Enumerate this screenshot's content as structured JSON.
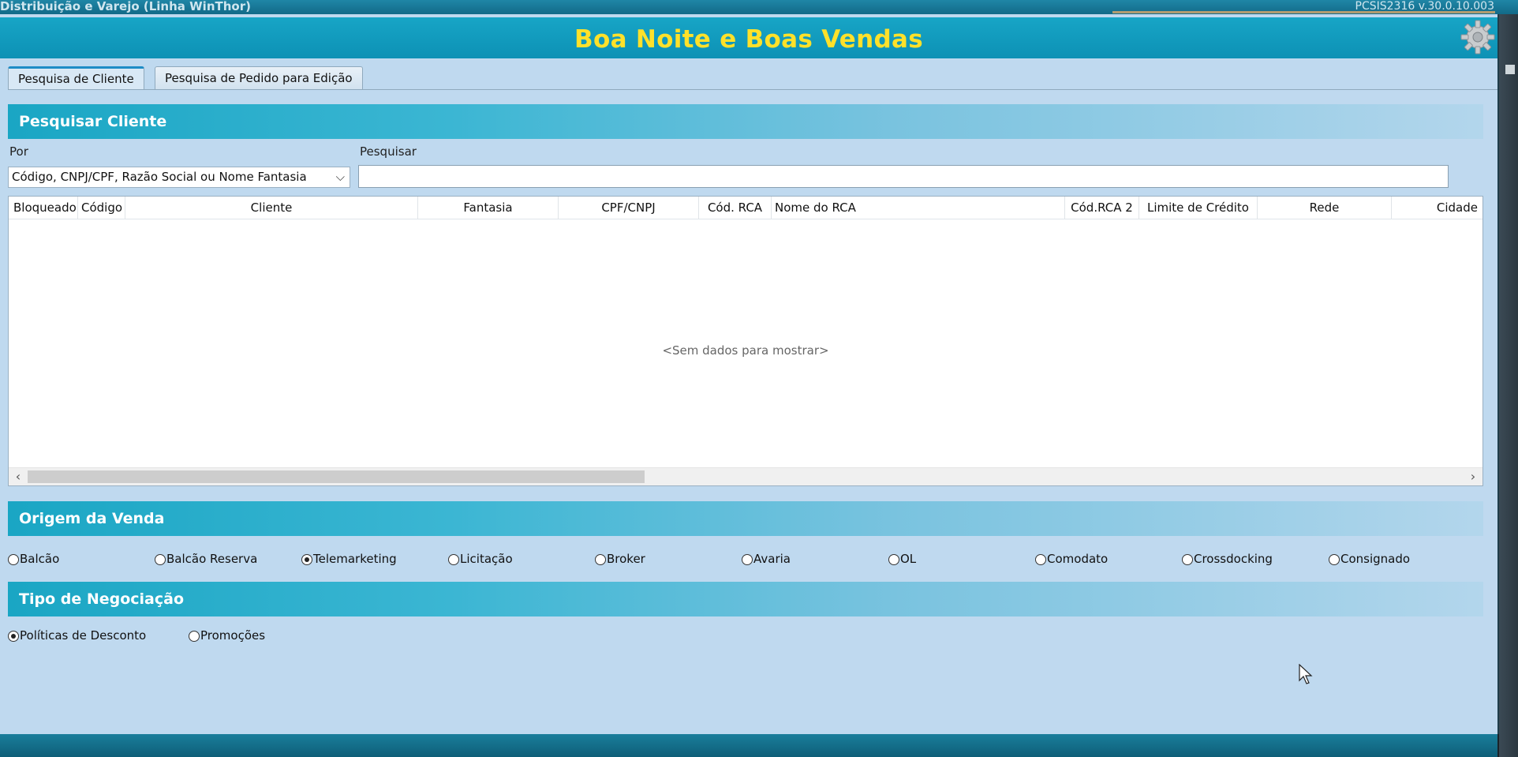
{
  "window": {
    "app_title": "Distribuição e Varejo (Linha WinThor)",
    "version": "PCSIS2316  v.30.0.10.003"
  },
  "banner": {
    "title": "Boa Noite e Boas Vendas"
  },
  "tabs": [
    {
      "label": "Pesquisa de Cliente",
      "active": true
    },
    {
      "label": "Pesquisa de Pedido para Edição",
      "active": false
    }
  ],
  "search_section": {
    "header": "Pesquisar Cliente",
    "por_label": "Por",
    "por_value": "Código, CNPJ/CPF, Razão Social ou Nome Fantasia",
    "pesquisar_label": "Pesquisar",
    "pesquisar_value": ""
  },
  "grid": {
    "columns": [
      "Bloqueado",
      "Código",
      "Cliente",
      "Fantasia",
      "CPF/CNPJ",
      "Cód. RCA",
      "Nome do RCA",
      "Cód.RCA 2",
      "Limite de Crédito",
      "Rede",
      "Cidade"
    ],
    "empty_text": "<Sem dados para mostrar>"
  },
  "origem": {
    "header": "Origem da Venda",
    "options": [
      "Balcão",
      "Balcão Reserva",
      "Telemarketing",
      "Licitação",
      "Broker",
      "Avaria",
      "OL",
      "Comodato",
      "Crossdocking",
      "Consignado"
    ],
    "selected": "Telemarketing"
  },
  "negociacao": {
    "header": "Tipo de Negociação",
    "options": [
      "Políticas de Desconto",
      "Promoções"
    ],
    "selected": "Políticas de Desconto"
  },
  "colors": {
    "banner_title": "#ffe12a",
    "banner_bg": "#17a5c6",
    "panel_bg": "#bfd9ef",
    "section_header": "#1aa6c4"
  },
  "icons": {
    "settings": "gear-icon",
    "dropdown": "chevron-down-icon"
  }
}
